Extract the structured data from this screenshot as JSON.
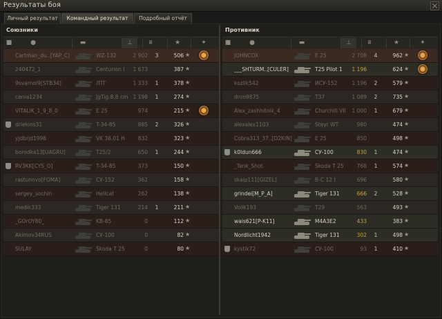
{
  "window": {
    "title": "Результаты боя"
  },
  "tabs": [
    {
      "label": "Личный результат",
      "active": false
    },
    {
      "label": "Командный результат",
      "active": true
    },
    {
      "label": "Подробный отчёт",
      "active": false
    }
  ],
  "allies": {
    "title": "Союзники",
    "rows": [
      {
        "name": "Cartman_du..[YAP_C]",
        "tank": "WZ-132",
        "dmg": "2 902",
        "kills": "3",
        "xp": "506",
        "medal": true,
        "dead": true
      },
      {
        "name": "240472_1",
        "tank": "Centurion I",
        "dmg": "1 673",
        "kills": "",
        "xp": "387",
        "dead": true
      },
      {
        "name": "9svarnoi9[STB34]",
        "tank": "ЛТГ",
        "dmg": "1 333",
        "kills": "1",
        "xp": "378",
        "dead": true
      },
      {
        "name": "cenia1234",
        "tank": "JgTig.8,8 cm",
        "dmg": "1 198",
        "kills": "1",
        "xp": "274",
        "dead": true
      },
      {
        "name": "VITALIK_1_9_8_0",
        "tank": "E 25",
        "dmg": "974",
        "kills": "",
        "xp": "215",
        "medal": true,
        "dead": true
      },
      {
        "name": "driekins31",
        "tank": "T-34-85",
        "dmg": "885",
        "kills": "2",
        "xp": "326",
        "squad": true,
        "dead": true
      },
      {
        "name": "yjdbrjd1998",
        "tank": "VK 36.01 H",
        "dmg": "832",
        "kills": "",
        "xp": "323",
        "dead": true
      },
      {
        "name": "borodka13[UAGRU]",
        "tank": "T25/2",
        "dmg": "650",
        "kills": "1",
        "xp": "244",
        "dead": true
      },
      {
        "name": "RV3KK[CYS_O]",
        "tank": "T-34-85",
        "dmg": "373",
        "kills": "",
        "xp": "150",
        "squad": true,
        "dead": true
      },
      {
        "name": "rastunovo[FOMA]",
        "tank": "СУ-152",
        "dmg": "362",
        "kills": "",
        "xp": "158",
        "dead": true
      },
      {
        "name": "sergey_sochin",
        "tank": "Hellcat",
        "dmg": "262",
        "kills": "",
        "xp": "138",
        "dead": true
      },
      {
        "name": "medik333",
        "tank": "Tiger 131",
        "dmg": "214",
        "kills": "1",
        "xp": "211",
        "dead": true
      },
      {
        "name": "_GOrOY80_",
        "tank": "KB-85",
        "dmg": "0",
        "kills": "",
        "xp": "112",
        "dead": true
      },
      {
        "name": "Akimov34RUS",
        "tank": "СУ-100",
        "dmg": "0",
        "kills": "",
        "xp": "82",
        "dead": true
      },
      {
        "name": "SULAY",
        "tank": "Škoda T 25",
        "dmg": "0",
        "kills": "",
        "xp": "80",
        "dead": true
      }
    ]
  },
  "enemies": {
    "title": "Противник",
    "rows": [
      {
        "name": "JOHNCOX",
        "tank": "E 25",
        "dmg": "2 708",
        "kills": "4",
        "xp": "962",
        "medal": true,
        "dead": true
      },
      {
        "name": "___SHTURM..[CULER]",
        "tank": "T25 Pilot 1",
        "dmg": "1 196",
        "kills": "",
        "xp": "624",
        "medal": true,
        "dead": false,
        "yellowDmg": true
      },
      {
        "name": "kozlik542",
        "tank": "ИСУ-152",
        "dmg": "1 196",
        "kills": "2",
        "xp": "579",
        "dead": true
      },
      {
        "name": "dron9875",
        "tank": "T37",
        "dmg": "1 089",
        "kills": "2",
        "xp": "735",
        "dead": true
      },
      {
        "name": "Alex_zashhitnik_4",
        "tank": "Churchill VII",
        "dmg": "1 000",
        "kills": "1",
        "xp": "679",
        "dead": true
      },
      {
        "name": "alexalex1103",
        "tank": "Steyr WT",
        "dmg": "980",
        "kills": "",
        "xp": "474",
        "dead": true
      },
      {
        "name": "Cobra313_37..[D2KIN]",
        "tank": "E 25",
        "dmg": "850",
        "kills": "",
        "xp": "498",
        "dead": true
      },
      {
        "name": "k0ldun666",
        "tank": "СУ-100",
        "dmg": "830",
        "kills": "1",
        "xp": "474",
        "squad": true,
        "dead": false,
        "yellowDmg": true
      },
      {
        "name": "_Tank_Shot",
        "tank": "Škoda T 25",
        "dmg": "768",
        "kills": "1",
        "xp": "574",
        "dead": true
      },
      {
        "name": "skaip111[GIZEL]",
        "tank": "B-C 12 t",
        "dmg": "696",
        "kills": "",
        "xp": "580",
        "dead": true
      },
      {
        "name": "grindei[M_P_A]",
        "tank": "Tiger 131",
        "dmg": "666",
        "kills": "2",
        "xp": "528",
        "dead": false,
        "yellowDmg": true
      },
      {
        "name": "Volik193",
        "tank": "T29",
        "dmg": "563",
        "kills": "",
        "xp": "493",
        "dead": true
      },
      {
        "name": "wais621[P-K11]",
        "tank": "M4A3E2",
        "dmg": "433",
        "kills": "",
        "xp": "383",
        "dead": false,
        "yellowDmg": true
      },
      {
        "name": "Nordlicht1942",
        "tank": "Tiger 131",
        "dmg": "302",
        "kills": "1",
        "xp": "498",
        "dead": false,
        "yellowDmg": true
      },
      {
        "name": "kystik72",
        "tank": "СУ-100",
        "dmg": "93",
        "kills": "1",
        "xp": "410",
        "squad": true,
        "dead": true
      }
    ]
  }
}
